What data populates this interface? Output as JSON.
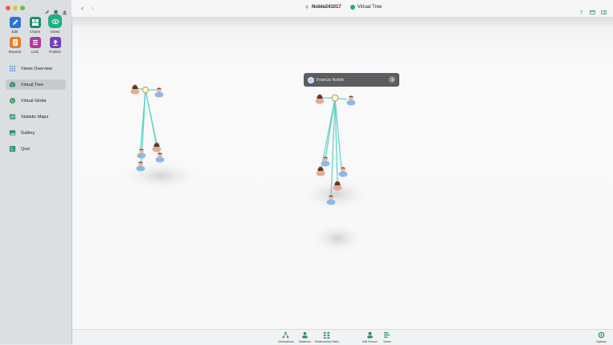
{
  "window": {
    "file_name": "Noble241017",
    "view_name": "Virtual Tree"
  },
  "modules": [
    {
      "label": "Edit",
      "color": "#2b73d9",
      "icon": "pencil-icon"
    },
    {
      "label": "Charts",
      "color": "#1a8c75",
      "icon": "chart-grid-icon"
    },
    {
      "label": "Views",
      "color": "#1eae83",
      "icon": "eye-icon",
      "active": true
    },
    {
      "label": "Reports",
      "color": "#e0812c",
      "icon": "document-icon"
    },
    {
      "label": "Lists",
      "color": "#b03aa0",
      "icon": "list-icon"
    },
    {
      "label": "Publish",
      "color": "#7b3fb4",
      "icon": "upload-icon"
    }
  ],
  "nav": [
    {
      "label": "Views Overview",
      "icon": "grid-dots-icon"
    },
    {
      "label": "Virtual Tree",
      "icon": "cube-icon",
      "selected": true
    },
    {
      "label": "Virtual Globe",
      "icon": "globe-icon"
    },
    {
      "label": "Statistic Maps",
      "icon": "map-icon"
    },
    {
      "label": "Gallery",
      "icon": "gallery-icon"
    },
    {
      "label": "Quiz",
      "icon": "quiz-icon"
    }
  ],
  "tooltip": {
    "name": "Francis Noble"
  },
  "bottombar": {
    "generations": "Generations",
    "relatives": "Relatives",
    "relationship_paths": "Relationship Paths",
    "edit_person": "Edit Person",
    "views": "Views",
    "options": "Options"
  },
  "colors": {
    "accent": "#1eae83",
    "link_line": "#5fd1c4",
    "male": "#8fb7ea",
    "female": "#e8a98c"
  }
}
